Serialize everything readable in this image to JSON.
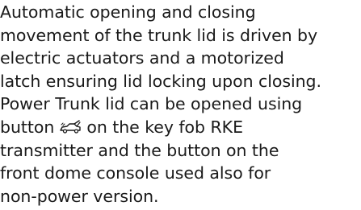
{
  "paragraph": {
    "lines": [
      "Automatic opening and closing",
      "movement of the trunk lid is driven by",
      "electric actuators and a motorized",
      "latch ensuring lid locking upon closing.",
      "Power Trunk lid can be opened using",
      "button",
      "on the key fob RKE",
      "transmitter and the button on the",
      "front dome console used also for",
      "non-power version."
    ]
  },
  "icons": {
    "trunk_button": "trunk-open-icon"
  },
  "colors": {
    "text": "#1a1a1a",
    "background": "#ffffff"
  }
}
